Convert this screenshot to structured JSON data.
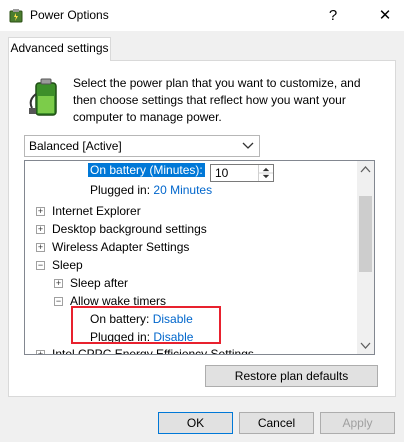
{
  "window": {
    "title": "Power Options",
    "help_glyph": "?",
    "close_glyph": "✕"
  },
  "tab": {
    "label": "Advanced settings"
  },
  "description": "Select the power plan that you want to customize, and then choose settings that reflect how you want your computer to manage power.",
  "plan_select": {
    "value": "Balanced [Active]"
  },
  "tree": {
    "on_battery_minutes_label": "On battery (Minutes):",
    "on_battery_minutes_value": "10",
    "plugged_in_label": "Plugged in:",
    "plugged_in_value": "20 Minutes",
    "internet_explorer": "Internet Explorer",
    "desktop_background": "Desktop background settings",
    "wireless_adapter": "Wireless Adapter Settings",
    "sleep": "Sleep",
    "sleep_after": "Sleep after",
    "allow_wake_timers": "Allow wake timers",
    "wake_on_battery_label": "On battery:",
    "wake_on_battery_value": "Disable",
    "wake_plugged_in_label": "Plugged in:",
    "wake_plugged_in_value": "Disable",
    "intel_cppc": "Intel CPPC Energy Efficiency Settings"
  },
  "buttons": {
    "restore": "Restore plan defaults",
    "ok": "OK",
    "cancel": "Cancel",
    "apply": "Apply"
  },
  "colors": {
    "link": "#0066cc",
    "selection": "#0078d7",
    "highlight_box": "#e8212e"
  }
}
